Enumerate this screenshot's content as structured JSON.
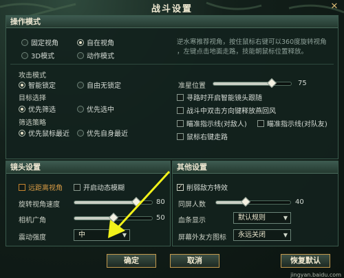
{
  "window": {
    "title": "战斗设置"
  },
  "operation": {
    "section_title": "操作模式",
    "modes": [
      {
        "label": "固定视角",
        "selected": false
      },
      {
        "label": "自在视角",
        "selected": true
      },
      {
        "label": "3D模式",
        "selected": false
      },
      {
        "label": "动作模式",
        "selected": false
      }
    ],
    "description": [
      "逆水寒推荐视角，按住鼠标右键可以360度旋转视角",
      "，左键点击地面走路，技能朝鼠标位置释放。"
    ],
    "attack_mode": {
      "label": "攻击模式",
      "options": [
        {
          "label": "智能锁定",
          "selected": true
        },
        {
          "label": "自由无锁定",
          "selected": false
        }
      ]
    },
    "target_select": {
      "label": "目标选择",
      "options": [
        {
          "label": "优先筛选",
          "selected": true
        },
        {
          "label": "优先选中",
          "selected": false
        }
      ]
    },
    "filter_strategy": {
      "label": "筛选策略",
      "options": [
        {
          "label": "优先鼠标最近",
          "selected": true
        },
        {
          "label": "优先自身最近",
          "selected": false
        }
      ]
    },
    "crosshair": {
      "label": "准星位置",
      "value": "75",
      "level": 0.75
    },
    "checks": [
      {
        "label": "寻路时开启智能镜头跟随",
        "checked": false
      },
      {
        "label": "战斗中双击方向键释放燕回风",
        "checked": false
      },
      {
        "label": "瞄准指示线(对敌人)",
        "checked": false
      },
      {
        "label": "瞄准指示线(对队友)",
        "checked": false
      },
      {
        "label": "鼠标右键走路",
        "checked": false
      }
    ]
  },
  "camera": {
    "section_title": "镜头设置",
    "far_view": {
      "label": "远距离视角",
      "checked": false
    },
    "motion_blur": {
      "label": "开启动态模糊",
      "checked": false
    },
    "rotate_speed": {
      "label": "旋转视角速度",
      "value": "80",
      "level": 0.8
    },
    "fov": {
      "label": "相机广角",
      "value": "50",
      "level": 0.5
    },
    "shake": {
      "label": "震动强度",
      "selected": "中"
    }
  },
  "other": {
    "section_title": "其他设置",
    "weaken_enemy": {
      "label": "削弱敌方特效",
      "checked": true
    },
    "same_screen": {
      "label": "同屏人数",
      "value": "40",
      "level": 0.4
    },
    "blood_bar": {
      "label": "血条显示",
      "selected": "默认规则"
    },
    "ally_icon": {
      "label": "屏幕外友方图标",
      "selected": "永远关闭"
    }
  },
  "footer": {
    "ok": "确定",
    "cancel": "取消",
    "restore": "恢复默认"
  },
  "watermark": "jingyan.baidu.com",
  "colors": {
    "accent_gold": "#c49a4d",
    "arrow_yellow": "#f2f21a",
    "panel_bg": "#12221d"
  },
  "icons": {
    "close": "close-icon",
    "chevron": "chevron-down-icon",
    "check": "check-icon"
  }
}
